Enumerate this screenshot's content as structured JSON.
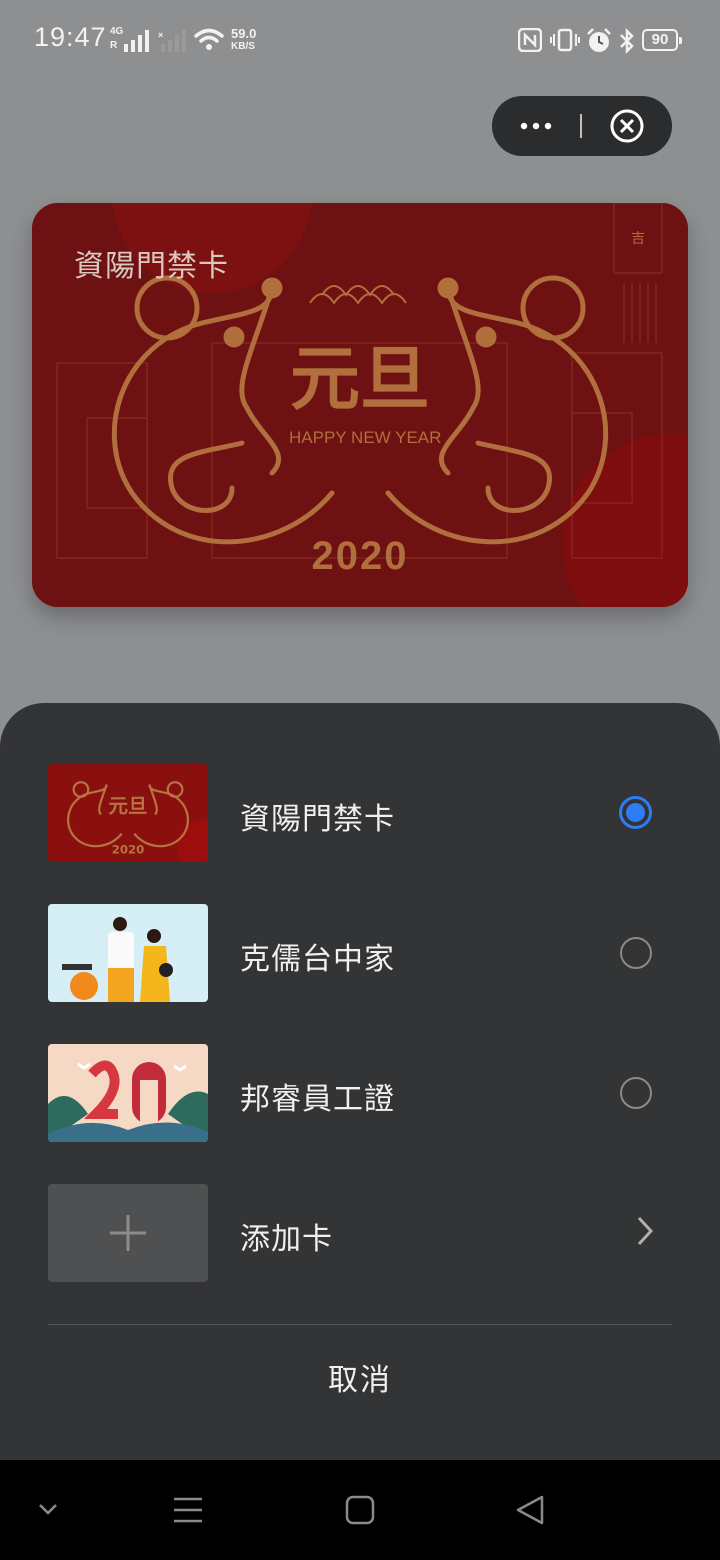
{
  "status_bar": {
    "time": "19:47",
    "network_type": "4G",
    "roaming": "R",
    "net_speed": "59.0",
    "net_speed_unit": "KB/S",
    "battery": "90",
    "icons": [
      "signal-icon",
      "signal-no-sim-icon",
      "wifi-icon",
      "nfc-icon",
      "vibrate-icon",
      "alarm-icon",
      "bluetooth-icon",
      "battery-icon"
    ]
  },
  "capsule": {
    "menu_icon": "more-dots-icon",
    "close_icon": "close-circle-icon"
  },
  "card": {
    "name": "資陽門禁卡",
    "art_main": "元旦",
    "art_sub": "HAPPY NEW YEAR",
    "art_year": "2020",
    "art_badge": "吉"
  },
  "sheet": {
    "cards": [
      {
        "label": "資陽門禁卡",
        "selected": true
      },
      {
        "label": "克儒台中家",
        "selected": false
      },
      {
        "label": "邦睿員工證",
        "selected": false
      }
    ],
    "add_label": "添加卡",
    "cancel_label": "取消"
  },
  "nav_bar": {
    "icons": [
      "collapse-icon",
      "menu-icon",
      "home-icon",
      "back-icon"
    ]
  },
  "colors": {
    "card_red": "#7a1214",
    "card_gold": "#a86a35",
    "selected_blue": "#2d7df6",
    "sheet_bg": "#333435"
  }
}
